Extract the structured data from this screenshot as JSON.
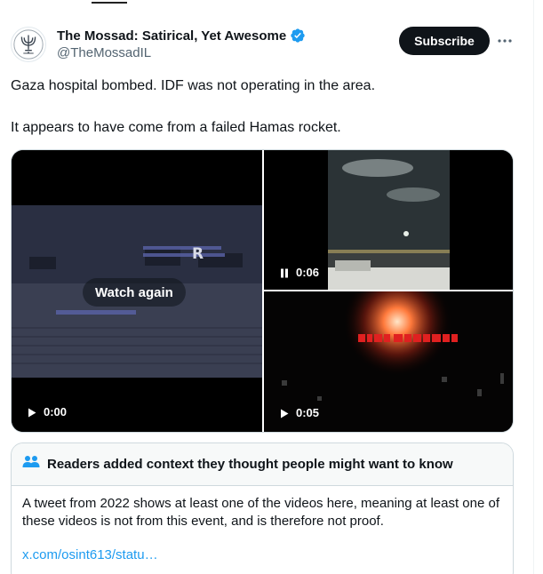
{
  "header": {
    "display_name": "The Mossad: Satirical, Yet Awesome",
    "handle": "@TheMossadIL",
    "subscribe_label": "Subscribe",
    "more_icon": "more-horizontal-icon",
    "verified_icon": "verified-badge-icon"
  },
  "tweet": {
    "lines": [
      "Gaza hospital bombed. IDF was not operating in the area.",
      "It appears to have come from a failed Hamas rocket."
    ]
  },
  "media": {
    "videos": [
      {
        "state": "paused",
        "time": "0:00",
        "overlay_label": "Watch again",
        "icon": "play-icon"
      },
      {
        "state": "playing",
        "time": "0:06",
        "icon": "pause-icon"
      },
      {
        "state": "paused",
        "time": "0:05",
        "icon": "play-icon"
      }
    ]
  },
  "community_note": {
    "icon": "people-icon",
    "title": "Readers added context they thought people might want to know",
    "body": "A tweet from 2022 shows at least one of the videos here, meaning at least one of these videos is not from this event, and is therefore not proof.",
    "link": "x.com/osint613/statu…"
  },
  "colors": {
    "text_primary": "#0f1419",
    "text_secondary": "#536471",
    "link": "#1d9bf0",
    "verified": "#1d9bf0",
    "button_bg": "#0f1419",
    "border": "#cfd9de",
    "note_head_bg": "#f7f9f9"
  }
}
